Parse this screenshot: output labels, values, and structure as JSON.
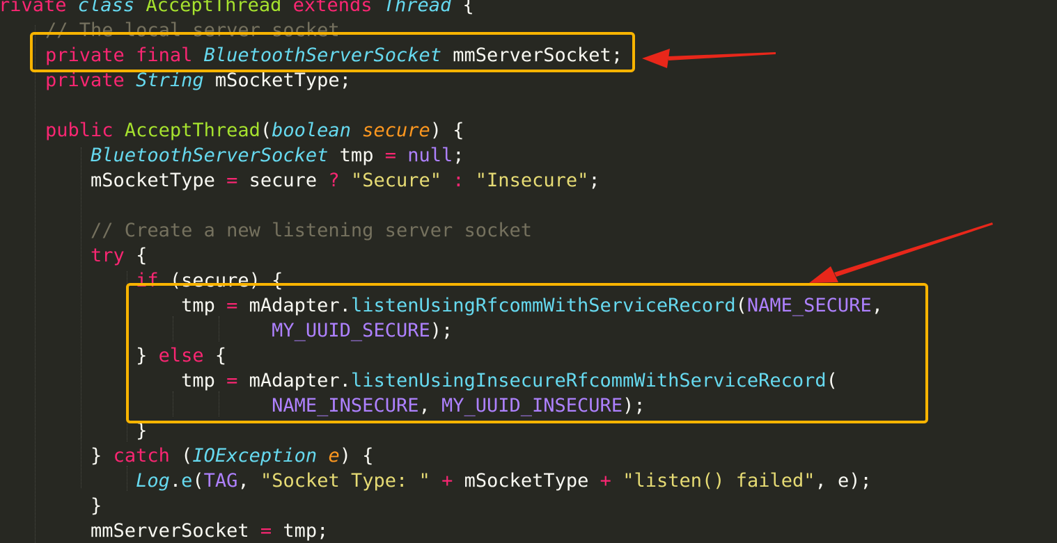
{
  "colors": {
    "background": "#272822",
    "keyword": "#f92672",
    "type": "#66d9ef",
    "function": "#a6e22e",
    "parameter": "#fd971f",
    "string": "#e6db74",
    "comment": "#75715e",
    "constant": "#ae81ff",
    "plain": "#f8f8f2",
    "highlight_box": "#f9b400",
    "arrow": "#e8271a"
  },
  "code": {
    "lines": [
      {
        "tokens": [
          {
            "t": "rivate ",
            "c": "kw"
          },
          {
            "t": "class ",
            "c": "typ"
          },
          {
            "t": "AcceptThread ",
            "c": "fn"
          },
          {
            "t": "extends ",
            "c": "kw"
          },
          {
            "t": "Thread",
            "c": "typ"
          },
          {
            "t": " {",
            "c": "pl"
          }
        ]
      },
      {
        "tokens": [
          {
            "t": "    // The local server socket",
            "c": "com"
          }
        ]
      },
      {
        "tokens": [
          {
            "t": "    private final ",
            "c": "kw"
          },
          {
            "t": "BluetoothServerSocket",
            "c": "typ"
          },
          {
            "t": " mmServerSocket;",
            "c": "pl"
          }
        ]
      },
      {
        "tokens": [
          {
            "t": "    private ",
            "c": "kw"
          },
          {
            "t": "String",
            "c": "typ"
          },
          {
            "t": " mSocketType;",
            "c": "pl"
          }
        ]
      },
      {
        "tokens": []
      },
      {
        "tokens": [
          {
            "t": "    public ",
            "c": "kw"
          },
          {
            "t": "AcceptThread",
            "c": "fn"
          },
          {
            "t": "(",
            "c": "pl"
          },
          {
            "t": "boolean ",
            "c": "typ"
          },
          {
            "t": "secure",
            "c": "par"
          },
          {
            "t": ") {",
            "c": "pl"
          }
        ]
      },
      {
        "tokens": [
          {
            "t": "        ",
            "c": "pl"
          },
          {
            "t": "BluetoothServerSocket",
            "c": "typ"
          },
          {
            "t": " tmp ",
            "c": "pl"
          },
          {
            "t": "=",
            "c": "kw"
          },
          {
            "t": " ",
            "c": "pl"
          },
          {
            "t": "null",
            "c": "cst"
          },
          {
            "t": ";",
            "c": "pl"
          }
        ]
      },
      {
        "tokens": [
          {
            "t": "        mSocketType ",
            "c": "pl"
          },
          {
            "t": "=",
            "c": "kw"
          },
          {
            "t": " secure ",
            "c": "pl"
          },
          {
            "t": "?",
            "c": "kw"
          },
          {
            "t": " ",
            "c": "pl"
          },
          {
            "t": "\"Secure\"",
            "c": "str"
          },
          {
            "t": " ",
            "c": "pl"
          },
          {
            "t": ":",
            "c": "kw"
          },
          {
            "t": " ",
            "c": "pl"
          },
          {
            "t": "\"Insecure\"",
            "c": "str"
          },
          {
            "t": ";",
            "c": "pl"
          }
        ]
      },
      {
        "tokens": []
      },
      {
        "tokens": [
          {
            "t": "        // Create a new listening server socket",
            "c": "com"
          }
        ]
      },
      {
        "tokens": [
          {
            "t": "        ",
            "c": "pl"
          },
          {
            "t": "try",
            "c": "kw"
          },
          {
            "t": " {",
            "c": "pl"
          }
        ]
      },
      {
        "tokens": [
          {
            "t": "            ",
            "c": "pl"
          },
          {
            "t": "if",
            "c": "kw"
          },
          {
            "t": " (secure) {",
            "c": "pl"
          }
        ]
      },
      {
        "tokens": [
          {
            "t": "                tmp ",
            "c": "pl"
          },
          {
            "t": "=",
            "c": "kw"
          },
          {
            "t": " mAdapter.",
            "c": "pl"
          },
          {
            "t": "listenUsingRfcommWithServiceRecord",
            "c": "mth"
          },
          {
            "t": "(",
            "c": "pl"
          },
          {
            "t": "NAME_SECURE",
            "c": "cst"
          },
          {
            "t": ",",
            "c": "pl"
          }
        ]
      },
      {
        "tokens": [
          {
            "t": "                        ",
            "c": "pl"
          },
          {
            "t": "MY_UUID_SECURE",
            "c": "cst"
          },
          {
            "t": ");",
            "c": "pl"
          }
        ]
      },
      {
        "tokens": [
          {
            "t": "            } ",
            "c": "pl"
          },
          {
            "t": "else",
            "c": "kw"
          },
          {
            "t": " {",
            "c": "pl"
          }
        ]
      },
      {
        "tokens": [
          {
            "t": "                tmp ",
            "c": "pl"
          },
          {
            "t": "=",
            "c": "kw"
          },
          {
            "t": " mAdapter.",
            "c": "pl"
          },
          {
            "t": "listenUsingInsecureRfcommWithServiceRecord",
            "c": "mth"
          },
          {
            "t": "(",
            "c": "pl"
          }
        ]
      },
      {
        "tokens": [
          {
            "t": "                        ",
            "c": "pl"
          },
          {
            "t": "NAME_INSECURE",
            "c": "cst"
          },
          {
            "t": ", ",
            "c": "pl"
          },
          {
            "t": "MY_UUID_INSECURE",
            "c": "cst"
          },
          {
            "t": ");",
            "c": "pl"
          }
        ]
      },
      {
        "tokens": [
          {
            "t": "            }",
            "c": "pl"
          }
        ]
      },
      {
        "tokens": [
          {
            "t": "        } ",
            "c": "pl"
          },
          {
            "t": "catch",
            "c": "kw"
          },
          {
            "t": " (",
            "c": "pl"
          },
          {
            "t": "IOException",
            "c": "typ"
          },
          {
            "t": " ",
            "c": "pl"
          },
          {
            "t": "e",
            "c": "par"
          },
          {
            "t": ") {",
            "c": "pl"
          }
        ]
      },
      {
        "tokens": [
          {
            "t": "            ",
            "c": "pl"
          },
          {
            "t": "Log",
            "c": "cls"
          },
          {
            "t": ".",
            "c": "pl"
          },
          {
            "t": "e",
            "c": "mth"
          },
          {
            "t": "(",
            "c": "pl"
          },
          {
            "t": "TAG",
            "c": "cst"
          },
          {
            "t": ", ",
            "c": "pl"
          },
          {
            "t": "\"Socket Type: \"",
            "c": "str"
          },
          {
            "t": " ",
            "c": "pl"
          },
          {
            "t": "+",
            "c": "kw"
          },
          {
            "t": " mSocketType ",
            "c": "pl"
          },
          {
            "t": "+",
            "c": "kw"
          },
          {
            "t": " ",
            "c": "pl"
          },
          {
            "t": "\"listen() failed\"",
            "c": "str"
          },
          {
            "t": ", e);",
            "c": "pl"
          }
        ]
      },
      {
        "tokens": [
          {
            "t": "        }",
            "c": "pl"
          }
        ]
      },
      {
        "tokens": [
          {
            "t": "        mmServerSocket ",
            "c": "pl"
          },
          {
            "t": "=",
            "c": "kw"
          },
          {
            "t": " tmp;",
            "c": "pl"
          }
        ]
      }
    ]
  },
  "annotations": [
    {
      "kind": "highlight-box",
      "target_lines": [
        2
      ]
    },
    {
      "kind": "highlight-box",
      "target_lines": [
        12,
        13,
        14,
        15,
        16
      ]
    },
    {
      "kind": "arrow",
      "points_to": "highlight-box-1"
    },
    {
      "kind": "arrow",
      "points_to": "highlight-box-2"
    }
  ]
}
